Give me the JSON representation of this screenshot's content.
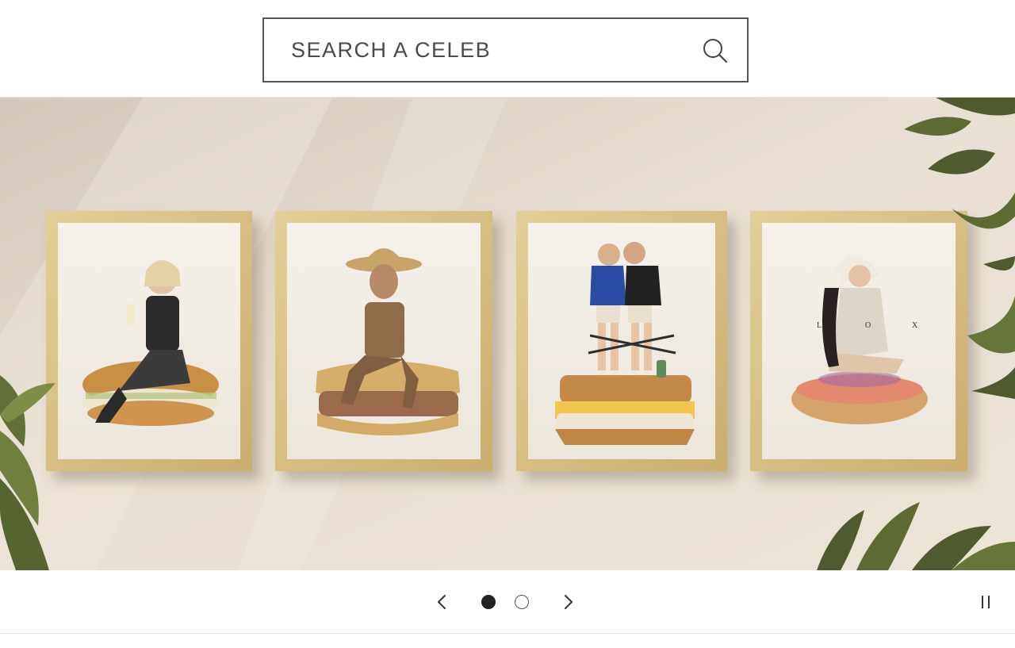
{
  "search": {
    "placeholder": "SEARCH A CELEB"
  },
  "hero": {
    "frames": [
      {
        "name": "frame-1"
      },
      {
        "name": "frame-2"
      },
      {
        "name": "frame-3"
      },
      {
        "name": "frame-4",
        "letters": [
          "L",
          "O",
          "X"
        ]
      }
    ]
  },
  "slideshow": {
    "slide_count": 2,
    "active_index": 0
  },
  "icons": {
    "search": "search-icon",
    "prev": "chevron-left-icon",
    "next": "chevron-right-icon",
    "pause": "pause-icon"
  },
  "colors": {
    "frame_wood": "#d6bf86",
    "wall": "#e9e0d3",
    "leaf": "#4f5a2e"
  }
}
